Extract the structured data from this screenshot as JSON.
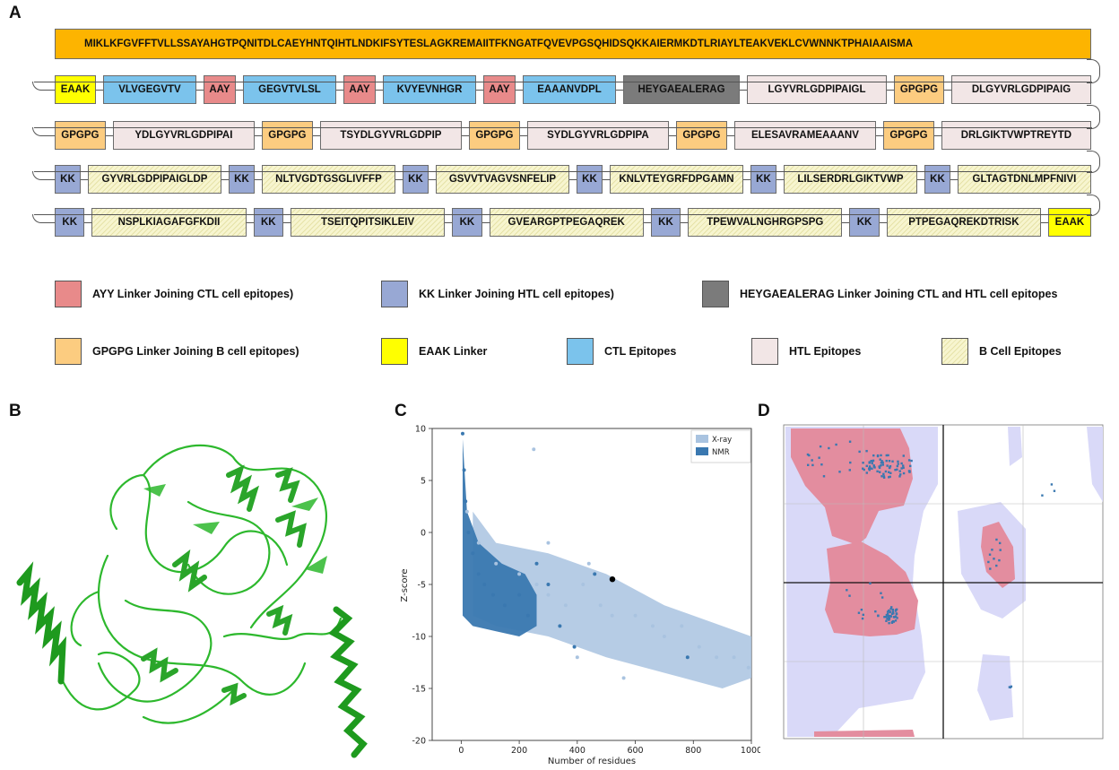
{
  "panels": {
    "a": "A",
    "b": "B",
    "c": "C",
    "d": "D"
  },
  "colors": {
    "signal": "#fdb400",
    "aay": "#e88a8a",
    "kk": "#98a8d4",
    "heyga": "#7b7b7b",
    "gpgpg": "#fccc80",
    "eaak": "#ffff00",
    "ctl": "#7bc3ec",
    "htl": "#f2e6e6",
    "bcell": "#f7f5cf"
  },
  "construct": {
    "signal_peptide": "MIKLKFGVFFTVLLSSAYAHGTPQNITDLCAEYHNTQIHTLNDKIFSYTESLAGKREMAIITFKNGATFQVEVPGSQHIDSQKKAIERMKDTLRIAYLTEAKVEKLCVWNNKTPHAIAAISMA",
    "rows": [
      [
        {
          "text": "EAAK",
          "type": "eaak"
        },
        {
          "text": "VLVGEGVTV",
          "type": "ctl"
        },
        {
          "text": "AAY",
          "type": "aay"
        },
        {
          "text": "GEGVTVLSL",
          "type": "ctl"
        },
        {
          "text": "AAY",
          "type": "aay"
        },
        {
          "text": "KVYEVNHGR",
          "type": "ctl"
        },
        {
          "text": "AAY",
          "type": "aay"
        },
        {
          "text": "EAAANVDPL",
          "type": "ctl"
        },
        {
          "text": "HEYGAEALERAG",
          "type": "heyga"
        },
        {
          "text": "LGYVRLGDPIPAIGL",
          "type": "htl"
        },
        {
          "text": "GPGPG",
          "type": "gpgpg"
        },
        {
          "text": "DLGYVRLGDPIPAIG",
          "type": "htl"
        }
      ],
      [
        {
          "text": "GPGPG",
          "type": "gpgpg"
        },
        {
          "text": "YDLGYVRLGDPIPAI",
          "type": "htl"
        },
        {
          "text": "GPGPG",
          "type": "gpgpg"
        },
        {
          "text": "TSYDLGYVRLGDPIP",
          "type": "htl"
        },
        {
          "text": "GPGPG",
          "type": "gpgpg"
        },
        {
          "text": "SYDLGYVRLGDPIPA",
          "type": "htl"
        },
        {
          "text": "GPGPG",
          "type": "gpgpg"
        },
        {
          "text": "ELESAVRAMEAAANV",
          "type": "htl"
        },
        {
          "text": "GPGPG",
          "type": "gpgpg"
        },
        {
          "text": "DRLGIKTVWPTREYTD",
          "type": "htl"
        }
      ],
      [
        {
          "text": "KK",
          "type": "kk"
        },
        {
          "text": "GYVRLGDPIPAIGLDP",
          "type": "bcell"
        },
        {
          "text": "KK",
          "type": "kk"
        },
        {
          "text": "NLTVGDTGSGLIVFFP",
          "type": "bcell"
        },
        {
          "text": "KK",
          "type": "kk"
        },
        {
          "text": "GSVVTVAGVSNFELIP",
          "type": "bcell"
        },
        {
          "text": "KK",
          "type": "kk"
        },
        {
          "text": "KNLVTEYGRFDPGAMN",
          "type": "bcell"
        },
        {
          "text": "KK",
          "type": "kk"
        },
        {
          "text": "LILSERDRLGIKTVWP",
          "type": "bcell"
        },
        {
          "text": "KK",
          "type": "kk"
        },
        {
          "text": "GLTAGTDNLMPFNIVI",
          "type": "bcell"
        }
      ],
      [
        {
          "text": "KK",
          "type": "kk"
        },
        {
          "text": "NSPLKIAGAFGFKDII",
          "type": "bcell"
        },
        {
          "text": "KK",
          "type": "kk"
        },
        {
          "text": "TSEITQPITSIKLEIV",
          "type": "bcell"
        },
        {
          "text": "KK",
          "type": "kk"
        },
        {
          "text": "GVEARGPTPEGAQREK",
          "type": "bcell"
        },
        {
          "text": "KK",
          "type": "kk"
        },
        {
          "text": "TPEWVALNGHRGPSPG",
          "type": "bcell"
        },
        {
          "text": "KK",
          "type": "kk"
        },
        {
          "text": "PTPEGAQREKDTRISK",
          "type": "bcell"
        },
        {
          "text": "EAAK",
          "type": "eaak"
        }
      ]
    ]
  },
  "legend": [
    {
      "type": "aay",
      "label": "AYY Linker Joining CTL cell epitopes)"
    },
    {
      "type": "kk",
      "label": "KK Linker Joining HTL cell epitopes)"
    },
    {
      "type": "heyga",
      "label": "HEYGAEALERAG Linker Joining CTL and HTL cell epitopes"
    },
    {
      "type": "gpgpg",
      "label": "GPGPG Linker Joining B cell epitopes)"
    },
    {
      "type": "eaak",
      "label": "EAAK Linker"
    },
    {
      "type": "ctl",
      "label": "CTL Epitopes"
    },
    {
      "type": "htl",
      "label": "HTL Epitopes"
    },
    {
      "type": "bcell",
      "label": "B Cell Epitopes"
    }
  ],
  "protein_color": "#2db82d",
  "chart_data": [
    {
      "type": "scatter",
      "panel": "C",
      "xlabel": "Number of residues",
      "ylabel": "Z-score",
      "xlim": [
        -100,
        1000
      ],
      "ylim": [
        -20,
        10
      ],
      "xticks": [
        0,
        200,
        400,
        600,
        800,
        1000
      ],
      "yticks": [
        10,
        5,
        0,
        -5,
        -10,
        -15,
        -20
      ],
      "legend_position": "top-right",
      "series": [
        {
          "name": "X-ray",
          "color": "#a9c3e0",
          "values": [
            [
              20,
              2
            ],
            [
              60,
              -1
            ],
            [
              120,
              -3
            ],
            [
              200,
              -4
            ],
            [
              260,
              -5
            ],
            [
              300,
              -6
            ],
            [
              360,
              -7
            ],
            [
              420,
              -5
            ],
            [
              480,
              -7
            ],
            [
              520,
              -8
            ],
            [
              600,
              -8
            ],
            [
              660,
              -9
            ],
            [
              700,
              -10
            ],
            [
              760,
              -9
            ],
            [
              820,
              -11
            ],
            [
              880,
              -12
            ],
            [
              940,
              -12
            ],
            [
              990,
              -13
            ],
            [
              560,
              -14
            ],
            [
              400,
              -12
            ],
            [
              250,
              8
            ],
            [
              300,
              -1
            ],
            [
              440,
              -3
            ]
          ]
        },
        {
          "name": "NMR",
          "color": "#3a78b0",
          "values": [
            [
              5,
              9.5
            ],
            [
              10,
              6
            ],
            [
              15,
              3
            ],
            [
              25,
              0
            ],
            [
              40,
              -2
            ],
            [
              60,
              -4
            ],
            [
              80,
              -5
            ],
            [
              110,
              -6
            ],
            [
              150,
              -7
            ],
            [
              200,
              -6
            ],
            [
              230,
              -8
            ],
            [
              260,
              -3
            ],
            [
              300,
              -5
            ],
            [
              340,
              -9
            ],
            [
              390,
              -11
            ],
            [
              460,
              -4
            ],
            [
              780,
              -12
            ]
          ]
        },
        {
          "name": "",
          "color": "#000000",
          "values": [
            [
              521,
              -4.5
            ]
          ]
        }
      ]
    }
  ],
  "ramachandran": {
    "favored_color": "#e38d9f",
    "allowed_color": "#d9d9f8",
    "line_color": "#111111"
  }
}
